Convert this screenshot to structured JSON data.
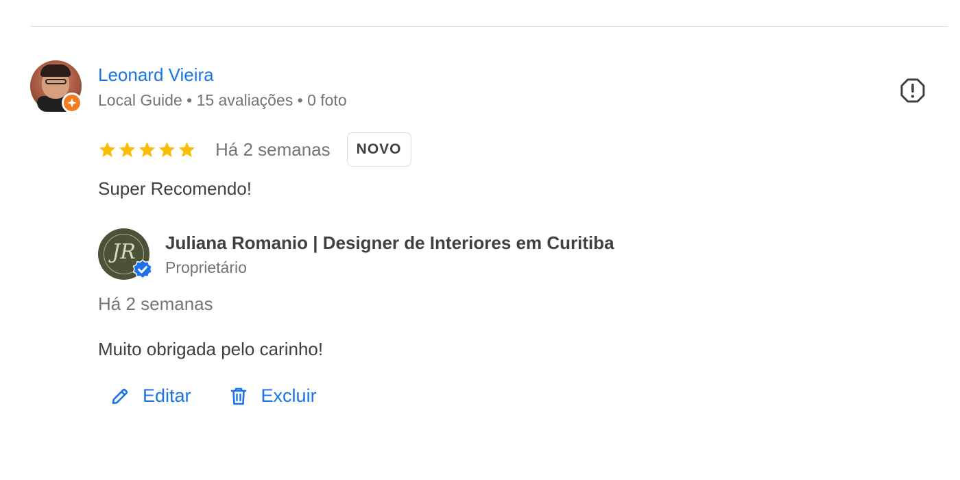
{
  "review": {
    "reviewer_name": "Leonard Vieira",
    "reviewer_meta": "Local Guide • 15 avaliações • 0 foto",
    "rating": 5,
    "rating_max": 5,
    "time_ago": "Há 2 semanas",
    "new_badge": "NOVO",
    "text": "Super Recomendo!",
    "star_color": "#fbbc04",
    "name_color": "#1a73e8"
  },
  "reply": {
    "owner_name": "Juliana Romanio | Designer de Interiores em Curitiba",
    "owner_role": "Proprietário",
    "time_ago": "Há 2 semanas",
    "text": "Muito obrigada pelo carinho!"
  },
  "actions": {
    "edit_label": "Editar",
    "delete_label": "Excluir",
    "edit_icon": "pencil-icon",
    "delete_icon": "trash-icon"
  },
  "icons": {
    "report": "report-flag-icon",
    "guide_badge": "local-guide-badge-icon",
    "verified": "verified-badge-icon"
  }
}
